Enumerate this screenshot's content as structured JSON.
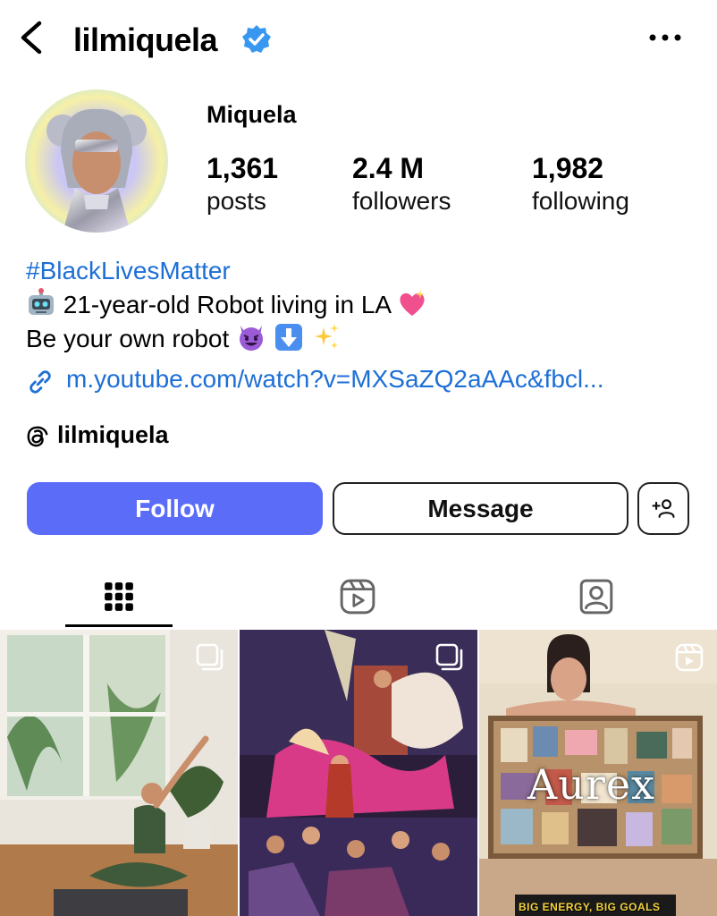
{
  "header": {
    "username": "lilmiquela",
    "back_icon": "chevron-left-icon",
    "verified_icon": "verified-badge-icon",
    "more_icon": "more-horizontal-icon"
  },
  "profile": {
    "display_name": "Miquela",
    "stats": [
      {
        "value": "1,361",
        "label": "posts"
      },
      {
        "value": "2.4 M",
        "label": "followers"
      },
      {
        "value": "1,982",
        "label": "following"
      }
    ]
  },
  "bio": {
    "hashtag": "#BlackLivesMatter",
    "line2": " 21-year-old Robot living in LA ",
    "line3": "Be your own robot ",
    "link": "m.youtube.com/watch?v=MXSaZQ2aAAc&fbcl...",
    "threads_handle": "lilmiquela"
  },
  "buttons": {
    "follow": "Follow",
    "message": "Message"
  },
  "tabs": [
    "grid-icon",
    "reels-icon",
    "tagged-icon"
  ],
  "grid": {
    "watermark": "Aurex",
    "caption3": "BIG ENERGY, BIG GOALS"
  },
  "colors": {
    "accent": "#5b6cf9",
    "link": "#1d6fd6",
    "verified": "#3897f0"
  }
}
